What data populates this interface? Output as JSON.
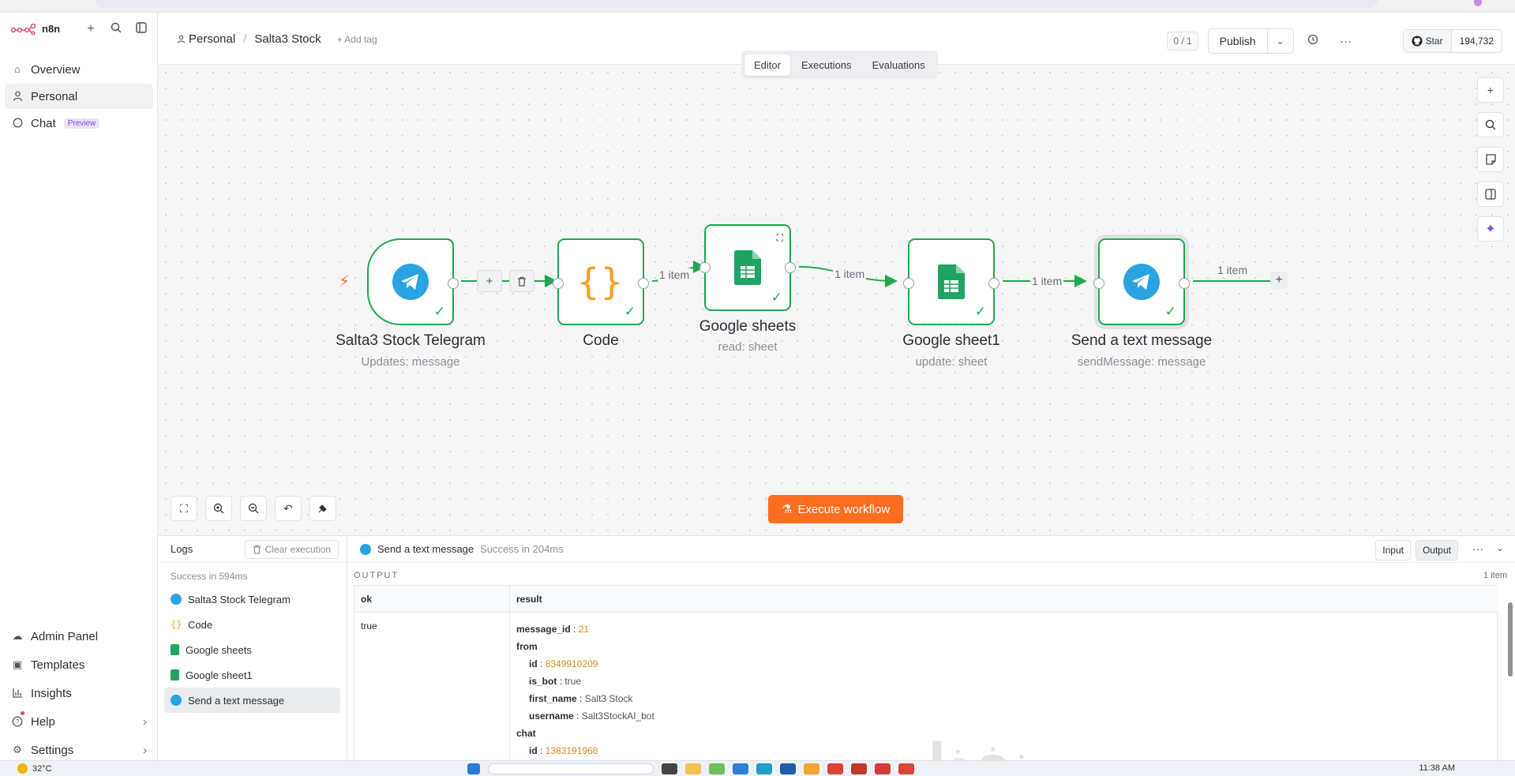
{
  "app": {
    "name": "n8n"
  },
  "sidebar": {
    "items": [
      {
        "label": "Overview",
        "icon": "home-icon"
      },
      {
        "label": "Personal",
        "icon": "user-icon"
      },
      {
        "label": "Chat",
        "icon": "chat-icon",
        "badge": "Preview"
      }
    ],
    "bottom_items": [
      {
        "label": "Admin Panel",
        "icon": "cloud-icon"
      },
      {
        "label": "Templates",
        "icon": "box-icon"
      },
      {
        "label": "Insights",
        "icon": "chart-icon"
      },
      {
        "label": "Help",
        "icon": "help-icon"
      },
      {
        "label": "Settings",
        "icon": "gear-icon"
      }
    ]
  },
  "header": {
    "breadcrumb_project": "Personal",
    "breadcrumb_workflow": "Salta3 Stock",
    "add_tag": "+ Add tag",
    "counter": "0 / 1",
    "publish_label": "Publish",
    "github_star": "Star",
    "github_count": "194,732"
  },
  "mode_tabs": [
    "Editor",
    "Executions",
    "Evaluations"
  ],
  "nodes": [
    {
      "title": "Salta3 Stock Telegram",
      "subtitle": "Updates: message"
    },
    {
      "title": "Code",
      "subtitle": ""
    },
    {
      "title": "Google sheets",
      "subtitle": "read: sheet"
    },
    {
      "title": "Google sheet1",
      "subtitle": "update: sheet"
    },
    {
      "title": "Send a text message",
      "subtitle": "sendMessage: message"
    }
  ],
  "edges": {
    "e2": "1 item",
    "e3": "1 item",
    "e4": "1 item",
    "e5": "1 item"
  },
  "execute_label": "Execute workflow",
  "logs": {
    "title": "Logs",
    "clear_label": "Clear execution",
    "success": "Success in 594ms",
    "items": [
      "Salta3 Stock Telegram",
      "Code",
      "Google sheets",
      "Google sheet1",
      "Send a text message"
    ]
  },
  "output": {
    "node_name": "Send a text message",
    "status": "Success in 204ms",
    "input_btn": "Input",
    "output_btn": "Output",
    "label": "OUTPUT",
    "count": "1 item",
    "col_ok": "ok",
    "col_result": "result",
    "ok_value": "true",
    "result": {
      "message_id_k": "message_id",
      "message_id_v": "21",
      "from_k": "from",
      "id_k": "id",
      "id_v": "8349910209",
      "is_bot_k": "is_bot",
      "is_bot_v": "true",
      "first_name_k": "first_name",
      "first_name_v": "Salt3 Stock",
      "username_k": "username",
      "username_v": "Salt3StockAI_bot",
      "chat_k": "chat",
      "chat_id_k": "id",
      "chat_id_v": "1383191968"
    }
  },
  "watermark": "نفذلي",
  "taskbar": {
    "temp": "32°C",
    "time": "11:38 AM"
  },
  "colors": {
    "accent": "#ff6d1f",
    "success": "#1eaa4c",
    "telegram": "#2aa3e1",
    "sheets": "#1fa463"
  }
}
